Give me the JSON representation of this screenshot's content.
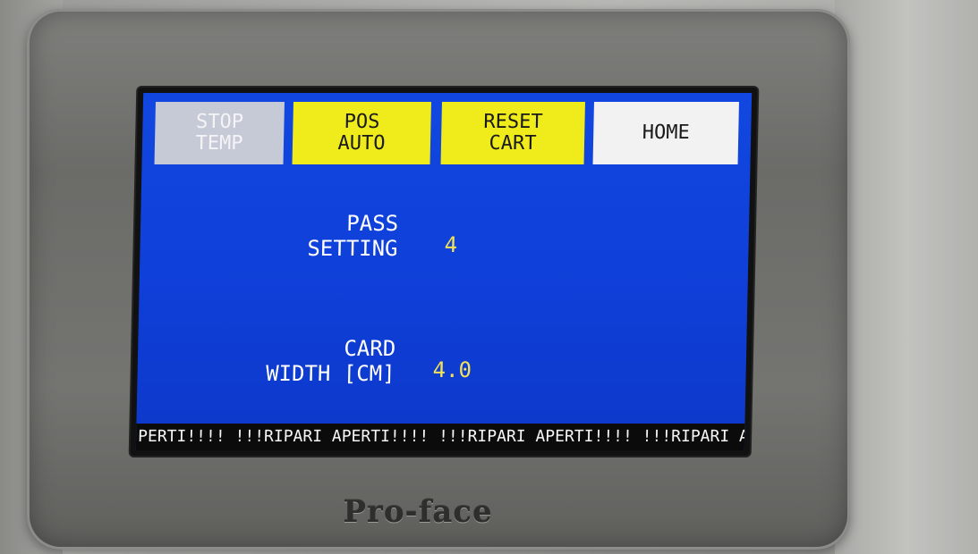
{
  "hmi": {
    "buttons": {
      "stop_temp": [
        "STOP",
        "TEMP"
      ],
      "pos_auto": [
        "POS",
        "AUTO"
      ],
      "reset_cart": [
        "RESET",
        "CART"
      ],
      "home": "HOME"
    },
    "fields": {
      "pass_setting": {
        "label": [
          "PASS",
          "SETTING"
        ],
        "value": "4"
      },
      "card_width": {
        "label": [
          "CARD",
          "WIDTH [CM]"
        ],
        "value": "4.0"
      }
    },
    "ticker_text": "PERTI!!!! !!!RIPARI APERTI!!!! !!!RIPARI APERTI!!!! !!!RIPARI A"
  },
  "brand": "Pro-face",
  "colors": {
    "screen_blue": "#1147e0",
    "button_yellow": "#f0ec1c",
    "button_gray": "#c6c9d6",
    "value_yellow": "#f1e05a"
  }
}
